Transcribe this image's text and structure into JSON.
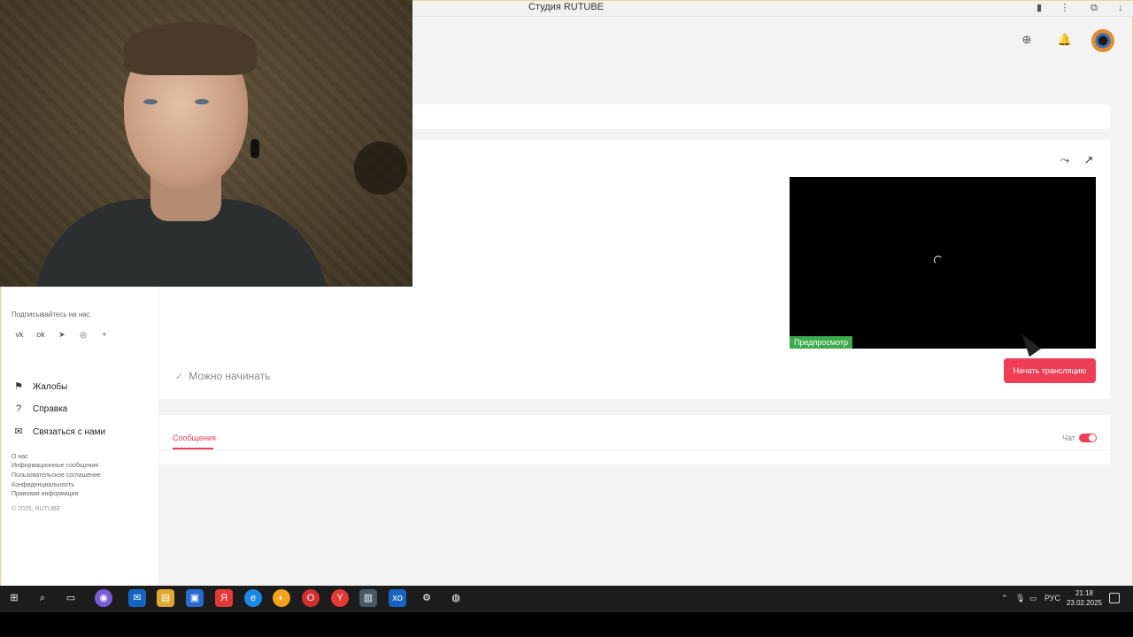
{
  "window": {
    "title": "Студия RUTUBE"
  },
  "stream": {
    "preview_badge": "Предпросмотр",
    "status": "Можно начинать",
    "start_button": "Начать трансляцию"
  },
  "chat": {
    "tab_messages": "Сообщения",
    "toggle_label": "Чат",
    "toggle_on": true
  },
  "sidebar": {
    "subscribe_label": "Подписывайтесь на нас",
    "social_icons": [
      "vk-icon",
      "odnoklassniki-icon",
      "telegram-icon",
      "viber-icon",
      "plus-icon"
    ],
    "links": [
      {
        "label": "Жалобы",
        "icon": "flag-icon"
      },
      {
        "label": "Справка",
        "icon": "help-icon"
      },
      {
        "label": "Связаться с нами",
        "icon": "mail-icon"
      }
    ],
    "footer_links": [
      "О нас",
      "Информационные сообщения",
      "Пользовательское соглашение",
      "Конфиденциальность",
      "Правовая информация"
    ],
    "copyright": "© 2025, RUTUBE"
  },
  "taskbar": {
    "language": "РУС",
    "time": "21:18",
    "date": "23.02.2025"
  },
  "colors": {
    "accent": "#ee3e55",
    "preview_badge": "#3dab4b",
    "taskbar": "#1c1c1c"
  }
}
